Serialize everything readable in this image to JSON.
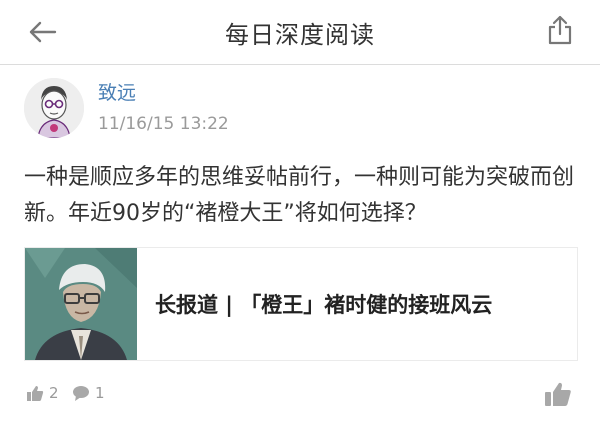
{
  "nav": {
    "title": "每日深度阅读",
    "back_icon": "back-arrow-icon",
    "share_icon": "share-icon"
  },
  "post": {
    "author": "致远",
    "time": "11/16/15 13:22",
    "text": "一种是顺应多年的思维妥帖前行，一种则可能为突破而创新。年近90岁的“褚橙大王”将如何选择？"
  },
  "link_card": {
    "title": "长报道 | 「橙王」褚时健的接班风云"
  },
  "footer": {
    "like_count": "2",
    "comment_count": "1"
  },
  "colors": {
    "author": "#4a7fb5",
    "muted": "#9a9a9a",
    "divider": "#dcdcdc"
  }
}
